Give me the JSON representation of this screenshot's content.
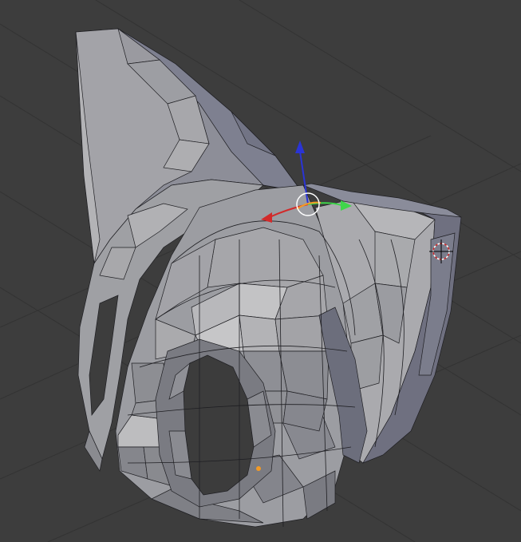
{
  "viewport": {
    "background": "#3d3d3d",
    "grid_color": "#333333",
    "wire_color": "#1e1e22",
    "mesh_light": "#a9a9ac",
    "mesh_mid": "#8d8e93",
    "mesh_dark": "#6b6d79",
    "gizmo": {
      "x_axis_color": "#d22a2a",
      "y_axis_color": "#3fd64b",
      "z_axis_color": "#2a34d6",
      "pivot_color": "#ffffff"
    },
    "selected_vertex_color": "#f39a25"
  }
}
